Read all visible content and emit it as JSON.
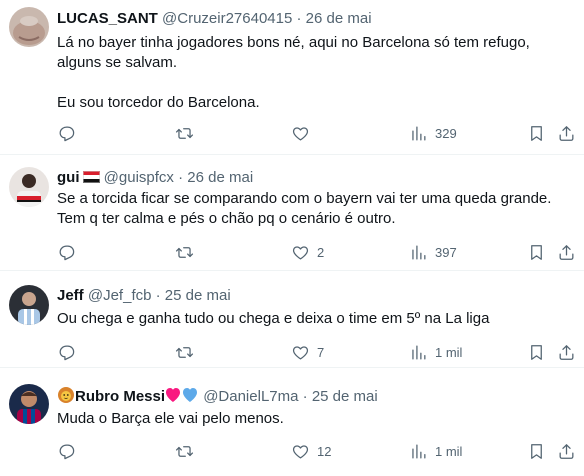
{
  "tweets": [
    {
      "name": "LUCAS_SANT",
      "handle": "@Cruzeir27640415",
      "sep": "·",
      "date": "26 de mai",
      "lines": [
        "Lá no bayer tinha jogadores bons né, aqui no Barcelona só tem refugo, alguns se salvam.",
        "Eu sou torcedor do Barcelona."
      ],
      "replies": "",
      "retweets": "",
      "likes": "",
      "views": "329"
    },
    {
      "name": "gui",
      "name_emoji": "flag-icon",
      "handle": "@guispfcx",
      "sep": "·",
      "date": "26 de mai",
      "lines": [
        "Se a torcida ficar se comparando com o bayern vai ter uma queda grande. Tem q ter calma e pés o chão pq o cenário é outro."
      ],
      "replies": "",
      "retweets": "",
      "likes": "2",
      "views": "397"
    },
    {
      "name": "Jeff",
      "handle": "@Jef_fcb",
      "sep": "·",
      "date": "25 de mai",
      "lines": [
        "Ou chega e ganha tudo ou chega e deixa o time em 5º na La liga"
      ],
      "replies": "",
      "retweets": "",
      "likes": "7",
      "views": "1 mil"
    },
    {
      "name_prefix_emoji": "lion-icon",
      "name": "Rubro Messi",
      "name_suffix_emoji": "hearts-icon",
      "handle": "@DanielL7ma",
      "sep": "·",
      "date": "25 de mai",
      "lines": [
        "Muda o Barça ele vai pelo menos."
      ],
      "replies": "",
      "retweets": "",
      "likes": "12",
      "views": "1 mil"
    }
  ],
  "colors": {
    "text": "#0f1419",
    "secondary": "#536471",
    "border": "#eff3f4",
    "heart_red": "#f91880",
    "heart_blue": "#5da9e9"
  }
}
